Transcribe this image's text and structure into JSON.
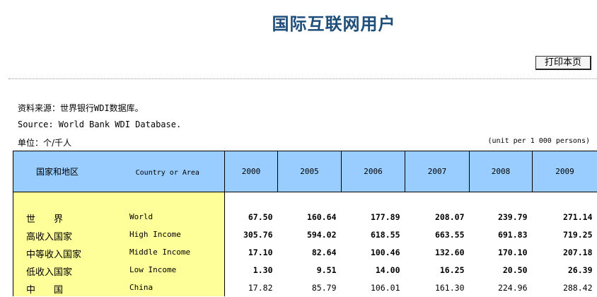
{
  "page": {
    "title": "国际互联网用户",
    "print_label": "打印本页"
  },
  "meta": {
    "source_zh": "资料来源：世界银行WDI数据库。",
    "source_en": "Source: World Bank WDI Database.",
    "unit_zh": "单位：个/千人",
    "unit_en": "(unit per 1 000 persons)"
  },
  "table": {
    "header_region_zh": "国家和地区",
    "header_region_en": "Country or Area",
    "years": [
      "2000",
      "2005",
      "2006",
      "2007",
      "2008",
      "2009"
    ],
    "rows": [
      {
        "zh": "世　　界",
        "en": "World",
        "values": [
          "67.50",
          "160.64",
          "177.89",
          "208.07",
          "239.79",
          "271.14"
        ]
      },
      {
        "zh": "高收入国家",
        "en": "High Income",
        "values": [
          "305.76",
          "594.02",
          "618.55",
          "663.55",
          "691.83",
          "719.25"
        ]
      },
      {
        "zh": "中等收入国家",
        "en": "Middle Income",
        "values": [
          "17.10",
          "82.64",
          "100.46",
          "132.60",
          "170.10",
          "207.18"
        ]
      },
      {
        "zh": "低收入国家",
        "en": "Low Income",
        "values": [
          "1.30",
          "9.51",
          "14.00",
          "16.25",
          "20.50",
          "26.39"
        ]
      },
      {
        "zh": "中　　国",
        "en": "China",
        "values": [
          "17.82",
          "85.79",
          "106.01",
          "161.30",
          "224.96",
          "288.42"
        ]
      }
    ]
  }
}
